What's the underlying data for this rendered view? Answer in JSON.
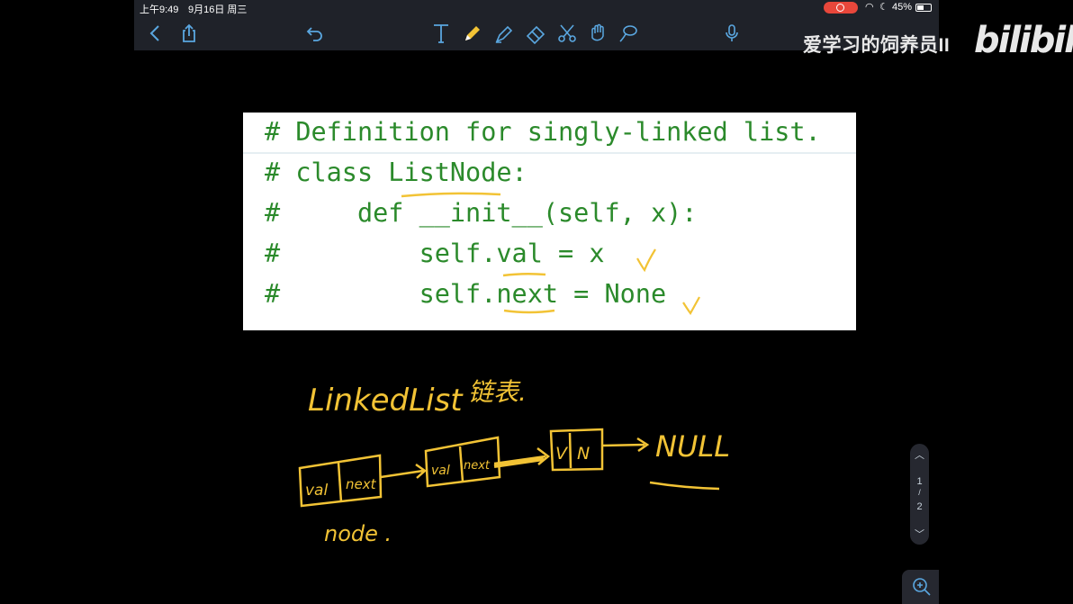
{
  "status_bar": {
    "time": "上午9:49",
    "date": "9月16日 周三",
    "battery": "45%",
    "record_color": "#e8473b"
  },
  "toolbar": {
    "icons": [
      "back-icon",
      "share-icon",
      "undo-icon",
      "text-tool-icon",
      "pencil-icon",
      "highlighter-icon",
      "eraser-icon",
      "scissors-icon",
      "hand-icon",
      "lasso-icon",
      "microphone-icon"
    ],
    "active_tool_color": "#f2c335",
    "icon_color": "#5aa7e0"
  },
  "watermark": {
    "channel": "爱学习的饲养员II",
    "logo": "bilibili"
  },
  "code": {
    "lines": [
      "# Definition for singly-linked list.",
      "# class ListNode:",
      "#     def __init__(self, x):",
      "#         self.val = x",
      "#         self.next = None"
    ],
    "color": "#2b8a2b"
  },
  "handwriting": {
    "title": "LinkedList",
    "title_cn": "链表.",
    "node1_val": "val",
    "node1_next": "next",
    "node2_val": "val",
    "node2_next": "next",
    "node3_val": "V",
    "node3_next": "N",
    "null_label": "NULL",
    "node_label": "node .",
    "ink_color": "#f2c335"
  },
  "page_nav": {
    "current": "1",
    "separator": "/",
    "total": "2"
  }
}
